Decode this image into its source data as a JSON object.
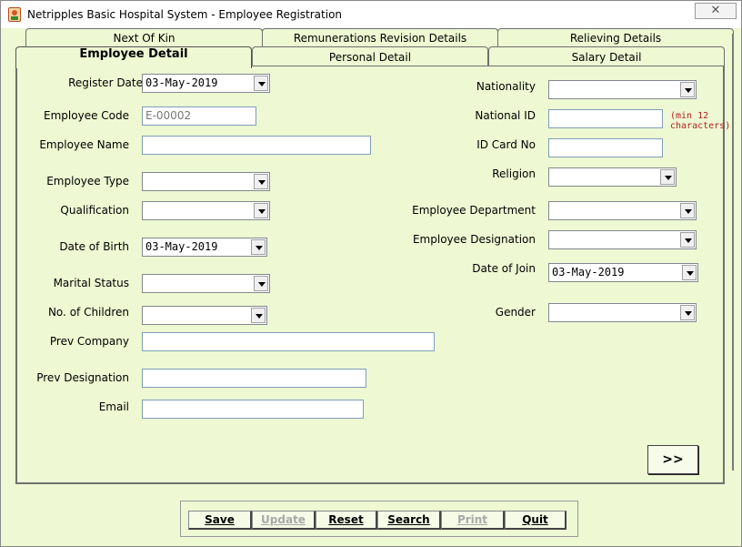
{
  "window": {
    "title": "Netripples Basic Hospital System - Employee Registration",
    "close_label": "✕"
  },
  "tabs": {
    "row1": [
      "Next Of Kin",
      "Remunerations Revision Details",
      "Relieving Details"
    ],
    "row2": [
      "Employee Detail",
      "Personal Detail",
      "Salary Detail"
    ],
    "active": "Employee Detail"
  },
  "form": {
    "register_date": {
      "label": "Register Date",
      "value": "03-May-2019"
    },
    "employee_code": {
      "label": "Employee Code",
      "value": "E-00002"
    },
    "employee_name": {
      "label": "Employee Name",
      "value": ""
    },
    "employee_type": {
      "label": "Employee Type",
      "value": ""
    },
    "qualification": {
      "label": "Qualification",
      "value": ""
    },
    "date_of_birth": {
      "label": "Date of Birth",
      "value": "03-May-2019"
    },
    "marital_status": {
      "label": "Marital Status",
      "value": ""
    },
    "no_of_children": {
      "label": "No. of Children",
      "value": ""
    },
    "prev_company": {
      "label": "Prev Company",
      "value": ""
    },
    "prev_designation": {
      "label": "Prev Designation",
      "value": ""
    },
    "email": {
      "label": "Email",
      "value": ""
    },
    "nationality": {
      "label": "Nationality",
      "value": ""
    },
    "national_id": {
      "label": "National ID",
      "value": "",
      "hint_line1": "(min 12",
      "hint_line2": "characters)"
    },
    "id_card_no": {
      "label": "ID Card No",
      "value": ""
    },
    "religion": {
      "label": "Religion",
      "value": ""
    },
    "employee_department": {
      "label": "Employee Department",
      "value": ""
    },
    "employee_designation": {
      "label": "Employee Designation",
      "value": ""
    },
    "date_of_join": {
      "label": "Date of Join",
      "value": "03-May-2019"
    },
    "gender": {
      "label": "Gender",
      "value": ""
    }
  },
  "next_label": ">>",
  "buttons": {
    "save": "Save",
    "update": "Update",
    "reset": "Reset",
    "search": "Search",
    "print": "Print",
    "quit": "Quit"
  },
  "colors": {
    "form_bg": "#eef8d2",
    "hint": "#b22222"
  }
}
